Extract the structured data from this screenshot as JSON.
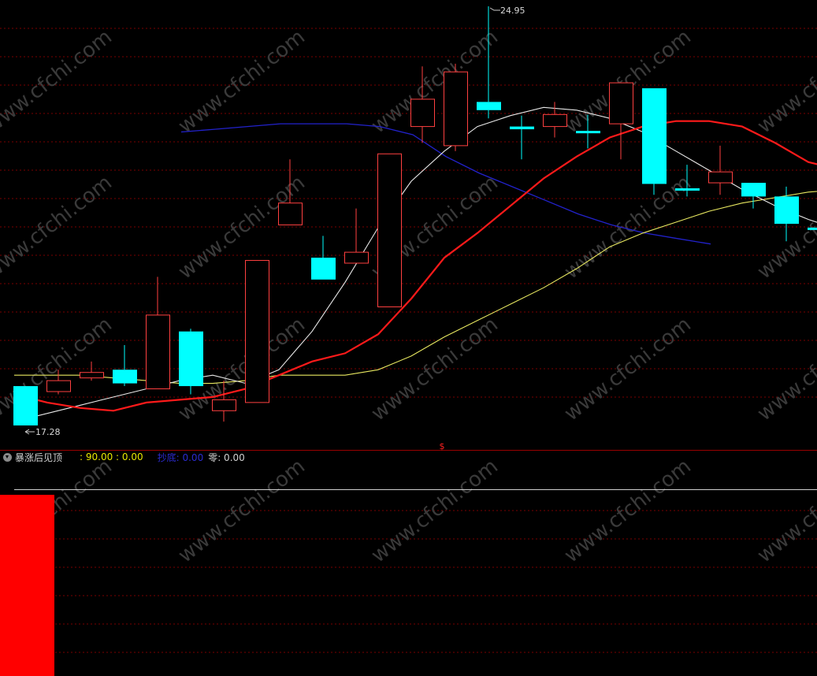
{
  "chart_data": {
    "type": "candlestick",
    "max_label": "24.95",
    "min_label": "17.28",
    "separator_mark": "$",
    "candles": [
      {
        "o": 18.0,
        "c": 17.28,
        "h": 17.95,
        "l": 17.28
      },
      {
        "o": 17.9,
        "c": 18.1,
        "h": 18.3,
        "l": 17.85
      },
      {
        "o": 18.15,
        "c": 18.25,
        "h": 18.45,
        "l": 18.1
      },
      {
        "o": 18.3,
        "c": 18.05,
        "h": 18.75,
        "l": 18.0
      },
      {
        "o": 17.95,
        "c": 19.3,
        "h": 20.0,
        "l": 17.95
      },
      {
        "o": 19.0,
        "c": 18.0,
        "h": 19.05,
        "l": 17.85
      },
      {
        "o": 17.55,
        "c": 17.75,
        "h": 18.1,
        "l": 17.35
      },
      {
        "o": 17.7,
        "c": 20.3,
        "h": 20.3,
        "l": 17.7
      },
      {
        "o": 20.95,
        "c": 21.35,
        "h": 22.15,
        "l": 20.95
      },
      {
        "o": 20.35,
        "c": 19.95,
        "h": 20.75,
        "l": 19.95
      },
      {
        "o": 20.25,
        "c": 20.45,
        "h": 21.25,
        "l": 20.25
      },
      {
        "o": 19.45,
        "c": 22.25,
        "h": 22.25,
        "l": 19.45
      },
      {
        "o": 22.75,
        "c": 23.25,
        "h": 23.85,
        "l": 22.45
      },
      {
        "o": 22.4,
        "c": 23.75,
        "h": 23.9,
        "l": 22.3
      },
      {
        "o": 23.2,
        "c": 23.05,
        "h": 24.95,
        "l": 22.9
      },
      {
        "o": 22.75,
        "c": 22.7,
        "h": 22.95,
        "l": 22.15
      },
      {
        "o": 22.75,
        "c": 22.97,
        "h": 23.2,
        "l": 22.55
      },
      {
        "o": 22.67,
        "c": 22.63,
        "h": 22.97,
        "l": 22.35
      },
      {
        "o": 22.8,
        "c": 23.55,
        "h": 23.55,
        "l": 22.15
      },
      {
        "o": 23.45,
        "c": 21.7,
        "h": 23.45,
        "l": 21.5
      },
      {
        "o": 21.62,
        "c": 21.58,
        "h": 22.05,
        "l": 21.47
      },
      {
        "o": 21.72,
        "c": 21.92,
        "h": 22.4,
        "l": 21.5
      },
      {
        "o": 21.72,
        "c": 21.47,
        "h": 21.72,
        "l": 21.25
      },
      {
        "o": 21.47,
        "c": 20.97,
        "h": 21.65,
        "l": 20.65
      },
      {
        "o": 20.9,
        "c": 20.87,
        "h": 21.15,
        "l": 20.7
      }
    ],
    "ma_white": [
      17.35,
      17.5,
      17.65,
      17.8,
      17.95,
      18.1,
      18.2,
      18.05,
      18.3,
      19.0,
      19.9,
      20.9,
      21.75,
      22.3,
      22.75,
      22.95,
      23.1,
      23.05,
      22.9,
      22.65,
      22.3,
      21.95,
      21.6,
      21.3,
      21.05,
      20.85
    ],
    "ma_red": [
      17.85,
      17.7,
      17.6,
      17.55,
      17.7,
      17.75,
      17.8,
      17.95,
      18.2,
      18.45,
      18.6,
      18.95,
      19.6,
      20.35,
      20.8,
      21.3,
      21.8,
      22.2,
      22.55,
      22.75,
      22.85,
      22.85,
      22.75,
      22.45,
      22.1,
      21.95
    ],
    "ma_yellow": [
      18.2,
      18.2,
      18.2,
      18.15,
      18.1,
      18.05,
      18.05,
      18.1,
      18.2,
      18.2,
      18.2,
      18.3,
      18.55,
      18.9,
      19.2,
      19.5,
      19.8,
      20.15,
      20.55,
      20.8,
      21.0,
      21.2,
      21.35,
      21.45,
      21.55,
      21.6
    ],
    "ma_blue": [
      22.65,
      22.7,
      22.75,
      22.8,
      22.8,
      22.8,
      22.75,
      22.6,
      22.2,
      21.9,
      21.65,
      21.4,
      21.15,
      20.95,
      20.8,
      20.7,
      20.6
    ],
    "indicator": {
      "value": 90.0,
      "max": 90.0
    }
  },
  "legend": {
    "name": "暴涨后见顶",
    "values": ": 90.00 : 0.00",
    "blue_label": "抄底: 0.00",
    "zero_label": "零: 0.00"
  },
  "colors": {
    "up": "#ff4040",
    "down": "#00ffff",
    "ma_white": "#e8e8e8",
    "ma_red": "#ff1a1a",
    "ma_yellow": "#e8e860",
    "ma_blue": "#2222cc",
    "grid": "#7a0000",
    "bar": "#ff0000"
  },
  "watermark": "www.cfchi.com"
}
